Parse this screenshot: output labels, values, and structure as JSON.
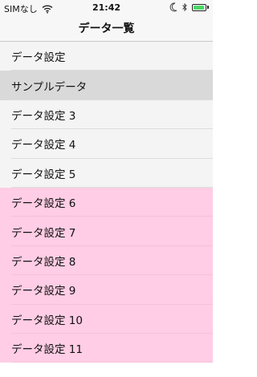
{
  "status_bar": {
    "carrier": "SIMなし",
    "time": "21:42",
    "battery_level": 0.9,
    "battery_color": "#4cd964",
    "icons": [
      "wifi-icon",
      "moon-icon",
      "bluetooth-icon",
      "battery-icon"
    ]
  },
  "nav": {
    "title": "データ一覧"
  },
  "colors": {
    "normal_row": "#f4f4f4",
    "selected_row": "#d9d9d9",
    "pink_row": "#ffcde5"
  },
  "rows": [
    {
      "label": "データ設定",
      "style": "white"
    },
    {
      "label": "サンプルデータ",
      "style": "gray"
    },
    {
      "label": "データ設定 3",
      "style": "white"
    },
    {
      "label": "データ設定 4",
      "style": "white"
    },
    {
      "label": "データ設定 5",
      "style": "white"
    },
    {
      "label": "データ設定 6",
      "style": "pink"
    },
    {
      "label": "データ設定 7",
      "style": "pink"
    },
    {
      "label": "データ設定 8",
      "style": "pink"
    },
    {
      "label": "データ設定 9",
      "style": "pink"
    },
    {
      "label": "データ設定 10",
      "style": "pink"
    },
    {
      "label": "データ設定 11",
      "style": "pink"
    }
  ]
}
